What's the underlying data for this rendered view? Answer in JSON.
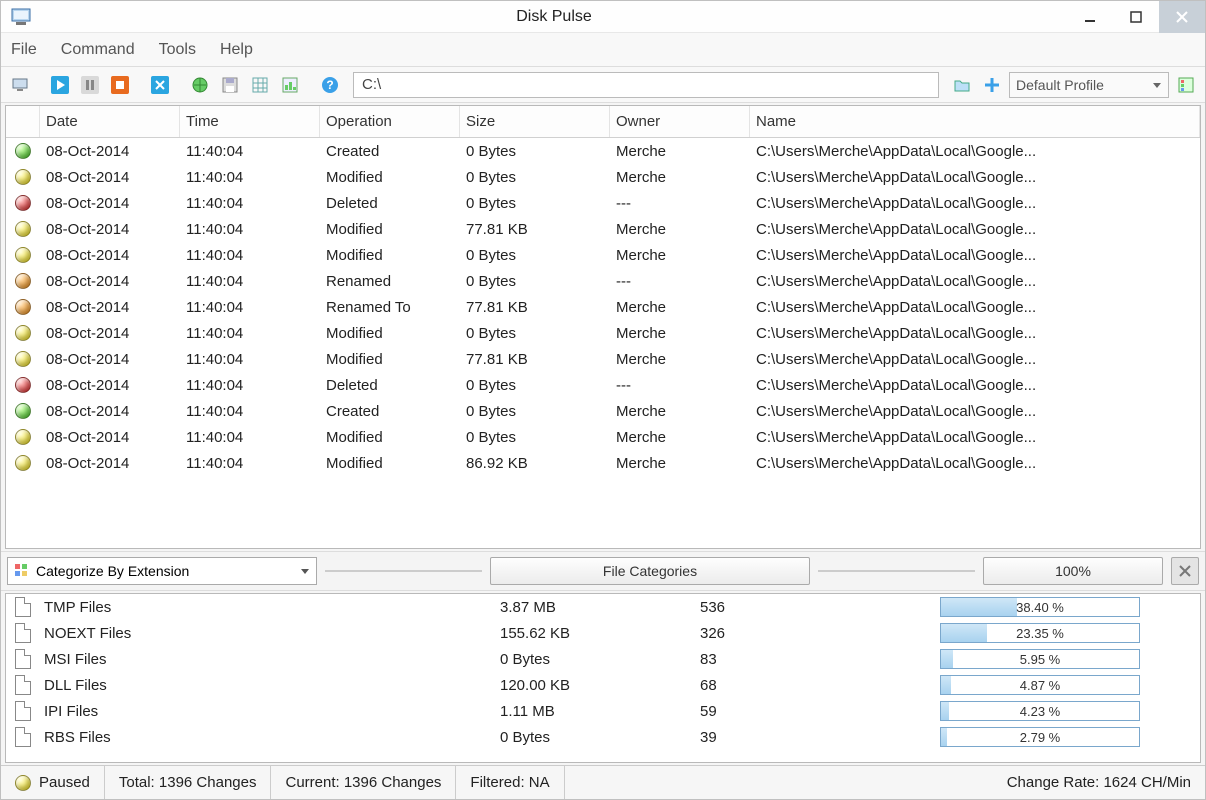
{
  "title": "Disk Pulse",
  "menubar": [
    "File",
    "Command",
    "Tools",
    "Help"
  ],
  "toolbar": {
    "path_value": "C:\\",
    "profile_label": "Default Profile"
  },
  "columns": [
    "Date",
    "Time",
    "Operation",
    "Size",
    "Owner",
    "Name"
  ],
  "rows": [
    {
      "c": "green",
      "date": "08-Oct-2014",
      "time": "11:40:04",
      "op": "Created",
      "size": "0 Bytes",
      "owner": "Merche",
      "name": "C:\\Users\\Merche\\AppData\\Local\\Google..."
    },
    {
      "c": "yellow",
      "date": "08-Oct-2014",
      "time": "11:40:04",
      "op": "Modified",
      "size": "0 Bytes",
      "owner": "Merche",
      "name": "C:\\Users\\Merche\\AppData\\Local\\Google..."
    },
    {
      "c": "red",
      "date": "08-Oct-2014",
      "time": "11:40:04",
      "op": "Deleted",
      "size": "0 Bytes",
      "owner": "---",
      "name": "C:\\Users\\Merche\\AppData\\Local\\Google..."
    },
    {
      "c": "yellow",
      "date": "08-Oct-2014",
      "time": "11:40:04",
      "op": "Modified",
      "size": "77.81 KB",
      "owner": "Merche",
      "name": "C:\\Users\\Merche\\AppData\\Local\\Google..."
    },
    {
      "c": "yellow",
      "date": "08-Oct-2014",
      "time": "11:40:04",
      "op": "Modified",
      "size": "0 Bytes",
      "owner": "Merche",
      "name": "C:\\Users\\Merche\\AppData\\Local\\Google..."
    },
    {
      "c": "orange",
      "date": "08-Oct-2014",
      "time": "11:40:04",
      "op": "Renamed",
      "size": "0 Bytes",
      "owner": "---",
      "name": "C:\\Users\\Merche\\AppData\\Local\\Google..."
    },
    {
      "c": "orange",
      "date": "08-Oct-2014",
      "time": "11:40:04",
      "op": "Renamed To",
      "size": "77.81 KB",
      "owner": "Merche",
      "name": "C:\\Users\\Merche\\AppData\\Local\\Google..."
    },
    {
      "c": "yellow",
      "date": "08-Oct-2014",
      "time": "11:40:04",
      "op": "Modified",
      "size": "0 Bytes",
      "owner": "Merche",
      "name": "C:\\Users\\Merche\\AppData\\Local\\Google..."
    },
    {
      "c": "yellow",
      "date": "08-Oct-2014",
      "time": "11:40:04",
      "op": "Modified",
      "size": "77.81 KB",
      "owner": "Merche",
      "name": "C:\\Users\\Merche\\AppData\\Local\\Google..."
    },
    {
      "c": "red",
      "date": "08-Oct-2014",
      "time": "11:40:04",
      "op": "Deleted",
      "size": "0 Bytes",
      "owner": "---",
      "name": "C:\\Users\\Merche\\AppData\\Local\\Google..."
    },
    {
      "c": "green",
      "date": "08-Oct-2014",
      "time": "11:40:04",
      "op": "Created",
      "size": "0 Bytes",
      "owner": "Merche",
      "name": "C:\\Users\\Merche\\AppData\\Local\\Google..."
    },
    {
      "c": "yellow",
      "date": "08-Oct-2014",
      "time": "11:40:04",
      "op": "Modified",
      "size": "0 Bytes",
      "owner": "Merche",
      "name": "C:\\Users\\Merche\\AppData\\Local\\Google..."
    },
    {
      "c": "yellow",
      "date": "08-Oct-2014",
      "time": "11:40:04",
      "op": "Modified",
      "size": "86.92 KB",
      "owner": "Merche",
      "name": "C:\\Users\\Merche\\AppData\\Local\\Google..."
    }
  ],
  "midbar": {
    "categorize_label": "Categorize By Extension",
    "filecat_label": "File Categories",
    "percent_label": "100%"
  },
  "categories": [
    {
      "name": "TMP Files",
      "size": "3.87 MB",
      "count": "536",
      "pct": "38.40 %",
      "pctv": 38.4
    },
    {
      "name": "NOEXT Files",
      "size": "155.62 KB",
      "count": "326",
      "pct": "23.35 %",
      "pctv": 23.35
    },
    {
      "name": "MSI Files",
      "size": "0 Bytes",
      "count": "83",
      "pct": "5.95 %",
      "pctv": 5.95
    },
    {
      "name": "DLL Files",
      "size": "120.00 KB",
      "count": "68",
      "pct": "4.87 %",
      "pctv": 4.87
    },
    {
      "name": "IPI Files",
      "size": "1.11 MB",
      "count": "59",
      "pct": "4.23 %",
      "pctv": 4.23
    },
    {
      "name": "RBS Files",
      "size": "0 Bytes",
      "count": "39",
      "pct": "2.79 %",
      "pctv": 2.79
    }
  ],
  "status": {
    "state": "Paused",
    "total": "Total: 1396 Changes",
    "current": "Current: 1396 Changes",
    "filtered": "Filtered: NA",
    "rate": "Change Rate: 1624 CH/Min"
  }
}
